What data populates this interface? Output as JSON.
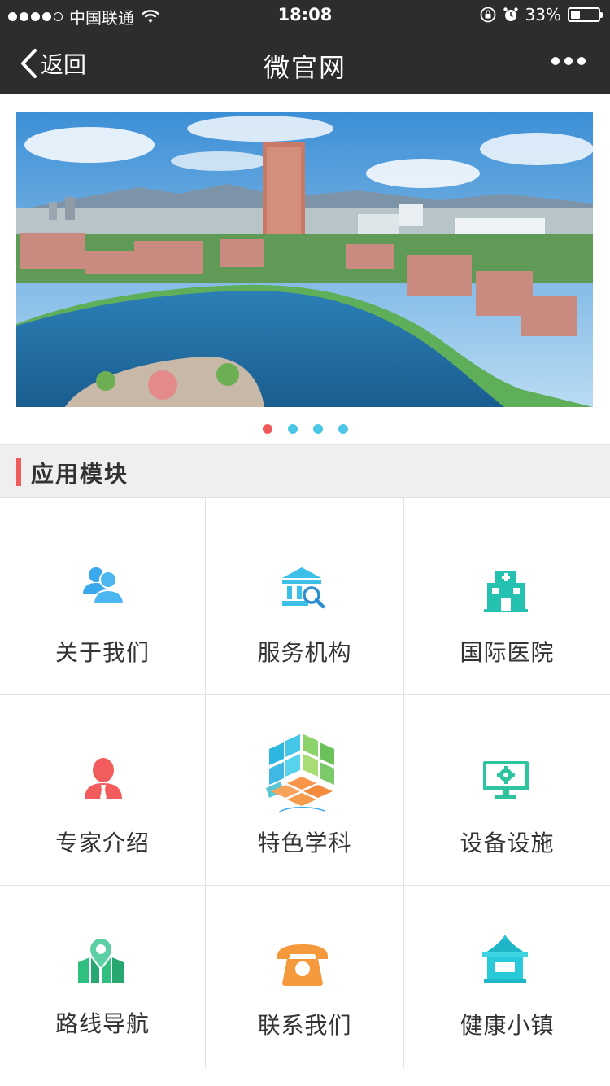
{
  "status_bar": {
    "carrier": "中国联通",
    "time": "18:08",
    "battery": "33%",
    "battery_level": 0.33
  },
  "nav": {
    "back_label": "返回",
    "title": "微官网"
  },
  "banner": {
    "page_count": 4,
    "active_page": 1
  },
  "section": {
    "title": "应用模块"
  },
  "modules": [
    {
      "label": "关于我们",
      "icon": "users-icon",
      "color": "#3aa8ec"
    },
    {
      "label": "服务机构",
      "icon": "institution-search-icon",
      "color": "#3cc0e8"
    },
    {
      "label": "国际医院",
      "icon": "hospital-icon",
      "color": "#25c1b0"
    },
    {
      "label": "专家介绍",
      "icon": "expert-icon",
      "color": "#f25c5c"
    },
    {
      "label": "特色学科",
      "icon": "cube-icon",
      "color": "#2cb6e0"
    },
    {
      "label": "设备设施",
      "icon": "monitor-gear-icon",
      "color": "#2ec4a0"
    },
    {
      "label": "路线导航",
      "icon": "map-pin-icon",
      "color": "#2fbf7f"
    },
    {
      "label": "联系我们",
      "icon": "telephone-icon",
      "color": "#f59a3c"
    },
    {
      "label": "健康小镇",
      "icon": "pavilion-icon",
      "color": "#28c9d8"
    }
  ]
}
